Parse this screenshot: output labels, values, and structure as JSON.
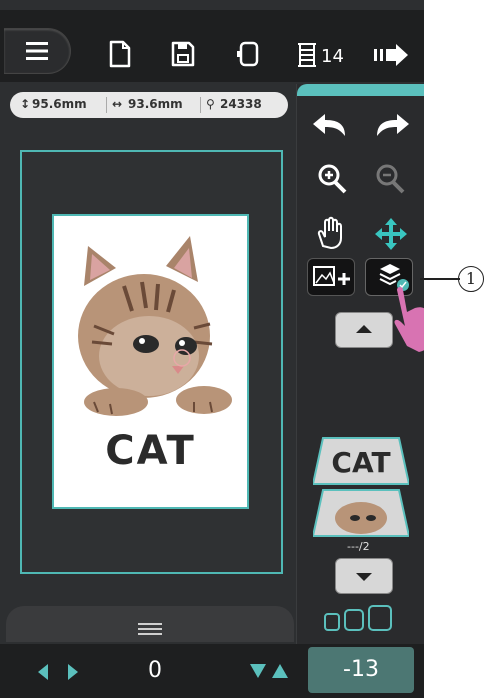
{
  "toolbar": {
    "icons": [
      "menu-icon",
      "new-file-icon",
      "save-icon",
      "hoop-icon",
      "stitch-count-icon",
      "transfer-icon"
    ],
    "stitch_count": "14"
  },
  "info": {
    "height": "95.6mm",
    "width": "93.6mm",
    "stitches": "24338"
  },
  "design": {
    "text": "CAT"
  },
  "panel": {
    "page_indicator": "---/2",
    "layer_text": "CAT"
  },
  "bottom": {
    "horizontal_value": "0",
    "vertical_value": "-13"
  },
  "annotation": {
    "callout": "1"
  },
  "colors": {
    "accent": "#5bc0bd",
    "background": "#2d2f31",
    "value_box": "#4c7773"
  }
}
